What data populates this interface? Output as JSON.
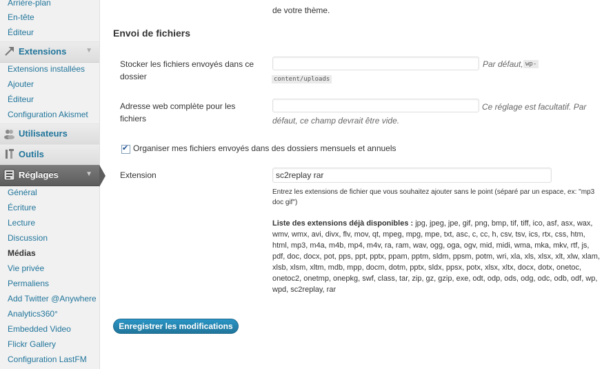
{
  "sidebar": {
    "appearance_items": [
      "Arrière-plan",
      "En-tête",
      "Éditeur"
    ],
    "extensions": {
      "label": "Extensions",
      "items": [
        "Extensions installées",
        "Ajouter",
        "Éditeur",
        "Configuration Akismet"
      ]
    },
    "users": {
      "label": "Utilisateurs"
    },
    "tools": {
      "label": "Outils"
    },
    "settings": {
      "label": "Réglages",
      "items": [
        "Général",
        "Écriture",
        "Lecture",
        "Discussion",
        "Médias",
        "Vie privée",
        "Permaliens",
        "Add Twitter @Anywhere",
        "Analytics360°",
        "Embedded Video",
        "Flickr Gallery",
        "Configuration LastFM"
      ],
      "current": "Médias"
    }
  },
  "main": {
    "top_desc": "de votre thème.",
    "section_title": "Envoi de fichiers",
    "upload_path": {
      "label": "Stocker les fichiers envoyés dans ce dossier",
      "value": "",
      "desc": "Par défaut,",
      "code": "wp-content/uploads"
    },
    "upload_url": {
      "label": "Adresse web complète pour les fichiers",
      "value": "",
      "desc": "Ce réglage est facultatif. Par défaut, ce champ devrait être vide."
    },
    "organize": {
      "label": "Organiser mes fichiers envoyés dans des dossiers mensuels et annuels",
      "checked": true
    },
    "extension": {
      "label": "Extension",
      "value": "sc2replay rar",
      "desc": "Entrez les extensions de fichier que vous souhaitez ajouter sans le point (séparé par un espace, ex: \"mp3 doc gif\")",
      "list_title": "Liste des extensions déjà disponibles :",
      "list": "jpg, jpeg, jpe, gif, png, bmp, tif, tiff, ico, asf, asx, wax, wmv, wmx, avi, divx, flv, mov, qt, mpeg, mpg, mpe, txt, asc, c, cc, h, csv, tsv, ics, rtx, css, htm, html, mp3, m4a, m4b, mp4, m4v, ra, ram, wav, ogg, oga, ogv, mid, midi, wma, mka, mkv, rtf, js, pdf, doc, docx, pot, pps, ppt, pptx, ppam, pptm, sldm, ppsm, potm, wri, xla, xls, xlsx, xlt, xlw, xlam, xlsb, xlsm, xltm, mdb, mpp, docm, dotm, pptx, sldx, ppsx, potx, xlsx, xltx, docx, dotx, onetoc, onetoc2, onetmp, onepkg, swf, class, tar, zip, gz, gzip, exe, odt, odp, ods, odg, odc, odb, odf, wp, wpd, sc2replay, rar"
    },
    "save_label": "Enregistrer les modifications"
  }
}
